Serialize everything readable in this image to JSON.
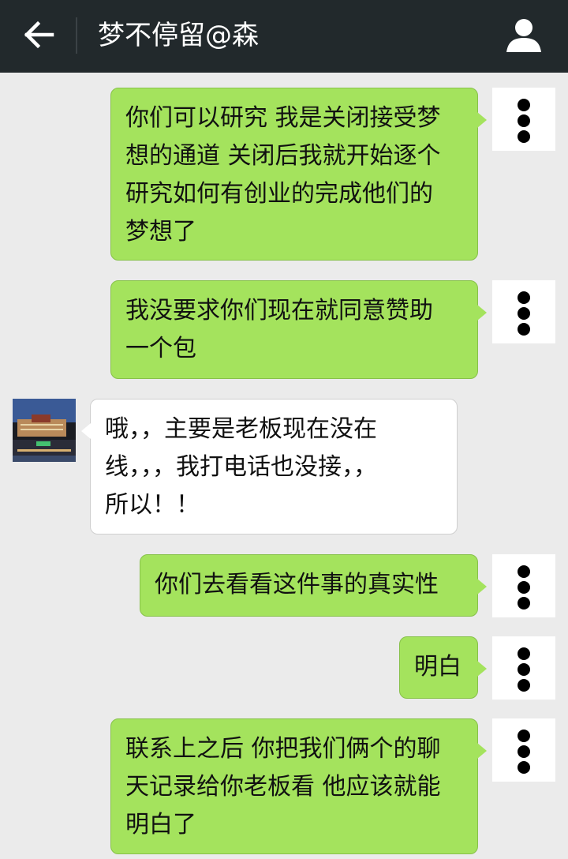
{
  "header": {
    "title": "梦不停留@森",
    "back_icon": "arrow-left-icon",
    "contact_icon": "person-icon",
    "bg_color": "#22292c"
  },
  "colors": {
    "outgoing_bubble": "#a4e35d",
    "incoming_bubble": "#ffffff",
    "background": "#ebebeb"
  },
  "messages": [
    {
      "direction": "out",
      "lines": [
        "你们可以研究 我是关闭接受梦",
        "想的通道 关闭后我就开始逐个",
        "研究如何有创业的完成他们的",
        "梦想了"
      ]
    },
    {
      "direction": "out",
      "lines": [
        "我没要求你们现在就同意赞助",
        "一个包"
      ]
    },
    {
      "direction": "in",
      "lines": [
        "哦，，主要是老板现在没在",
        "线，，，我打电话也没接，，",
        "所以！！"
      ]
    },
    {
      "direction": "out",
      "lines": [
        "你们去看看这件事的真实性"
      ]
    },
    {
      "direction": "out",
      "lines": [
        "明白"
      ]
    },
    {
      "direction": "out",
      "lines": [
        "联系上之后 你把我们俩个的聊",
        "天记录给你老板看 他应该就能",
        "明白了"
      ]
    }
  ]
}
